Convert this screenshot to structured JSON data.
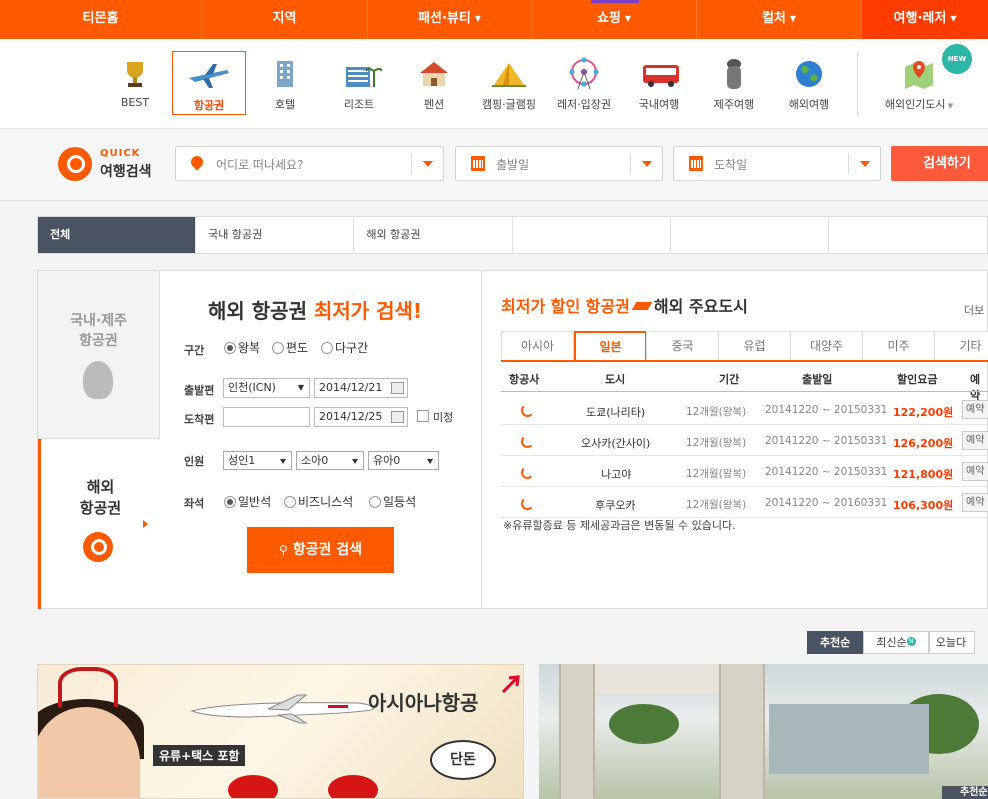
{
  "topnav": {
    "items": [
      {
        "label": "티몬홈",
        "dropdown": false
      },
      {
        "label": "지역",
        "dropdown": false
      },
      {
        "label": "패션·뷰티",
        "dropdown": true
      },
      {
        "label": "쇼핑",
        "dropdown": true
      },
      {
        "label": "컬처",
        "dropdown": true
      },
      {
        "label": "여행·레저",
        "dropdown": true
      }
    ],
    "active_index": 5
  },
  "categories": [
    {
      "label": "BEST",
      "icon": "trophy-icon"
    },
    {
      "label": "항공권",
      "icon": "airplane-icon",
      "active": true
    },
    {
      "label": "호텔",
      "icon": "hotel-icon"
    },
    {
      "label": "리조트",
      "icon": "resort-icon"
    },
    {
      "label": "펜션",
      "icon": "pension-icon"
    },
    {
      "label": "캠핑·글램핑",
      "icon": "tent-icon"
    },
    {
      "label": "레저·입장권",
      "icon": "ferris-wheel-icon"
    },
    {
      "label": "국내여행",
      "icon": "bus-icon"
    },
    {
      "label": "제주여행",
      "icon": "dolharubang-icon"
    },
    {
      "label": "해외여행",
      "icon": "globe-icon"
    },
    {
      "label": "해외인기도시",
      "icon": "map-icon"
    }
  ],
  "new_badge": "NEW",
  "quick_search": {
    "title_top": "QUICK",
    "title_bottom": "여행검색",
    "destination_placeholder": "어디로 떠나세요?",
    "depart_placeholder": "출발일",
    "arrive_placeholder": "도착일",
    "search_button": "검색하기"
  },
  "tabs": [
    "전체",
    "국내 항공권",
    "해외 항공권",
    "",
    "",
    ""
  ],
  "side": {
    "domestic_line1": "국내·제주",
    "domestic_line2": "항공권",
    "intl_line1": "해외",
    "intl_line2": "항공권"
  },
  "form": {
    "heading": "해외 항공권",
    "heading_accent": "최저가 검색!",
    "route_label": "구간",
    "route_options": [
      "왕복",
      "편도",
      "다구간"
    ],
    "route_selected": "왕복",
    "depart_label": "출발편",
    "depart_airport": "인천(ICN)",
    "depart_date": "2014/12/21",
    "arrive_label": "도착편",
    "arrive_airport": "",
    "arrive_date": "2014/12/25",
    "undecided_label": "미정",
    "pax_label": "인원",
    "adult": "성인1",
    "child": "소아0",
    "infant": "유아0",
    "seat_label": "좌석",
    "seat_options": [
      "일반석",
      "비즈니스석",
      "일등석"
    ],
    "seat_selected": "일반석",
    "search_button": "항공권 검색"
  },
  "deals": {
    "title_accent": "최저가 할인 항공권",
    "title": "해외 주요도시",
    "more": "더보",
    "region_tabs": [
      "아시아",
      "일본",
      "중국",
      "유럽",
      "대양주",
      "미주",
      "기타"
    ],
    "region_active": "일본",
    "columns": [
      "항공사",
      "도시",
      "기간",
      "출발일",
      "할인요금",
      "예약"
    ],
    "rows": [
      {
        "city": "도쿄(나리타)",
        "period": "12개월(왕복)",
        "dates": "20141220 ~ 20150331",
        "price": "122,200원",
        "action": "예약"
      },
      {
        "city": "오사카(간사이)",
        "period": "12개월(왕복)",
        "dates": "20141220 ~ 20150331",
        "price": "126,200원",
        "action": "예약"
      },
      {
        "city": "나고야",
        "period": "12개월(왕복)",
        "dates": "20141220 ~ 20150331",
        "price": "121,800원",
        "action": "예약"
      },
      {
        "city": "후쿠오카",
        "period": "12개월(왕복)",
        "dates": "20141220 ~ 20160331",
        "price": "106,300원",
        "action": "예약"
      }
    ],
    "note": "※유류할증료 등 제세공과금은 변동될 수 있습니다."
  },
  "sort_tabs": [
    "추천순",
    "최신순",
    "오늘다"
  ],
  "sort_new_badge": "N",
  "banner": {
    "airline": "아시아나항공",
    "tag": "유류+택스 포함",
    "bubble": "단돈"
  },
  "corner_label": "추천순",
  "colors": {
    "brand": "#ff5a00",
    "dark": "#4a5361"
  }
}
